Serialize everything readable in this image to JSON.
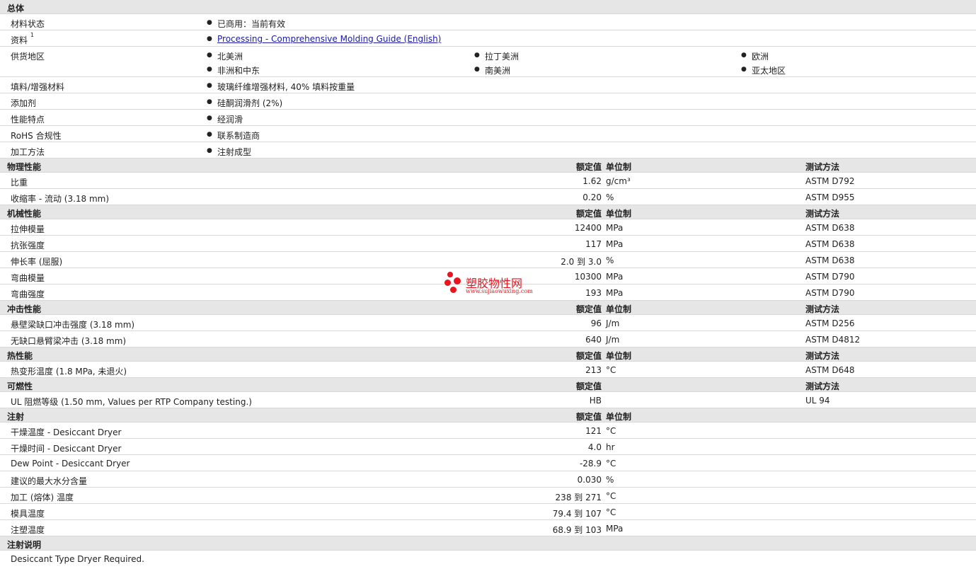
{
  "general": {
    "title": "总体",
    "status_label": "材料状态",
    "status_value": "已商用：当前有效",
    "docs_label": "资料",
    "docs_sup": "1",
    "docs_link": "Processing - Comprehensive Molding Guide (English)",
    "supply_label": "供货地区",
    "regions": [
      "北美洲",
      "拉丁美洲",
      "欧洲",
      "非洲和中东",
      "南美洲",
      "亚太地区"
    ],
    "filler_label": "填料/增强材料",
    "filler_value": "玻璃纤维增强材料, 40% 填料按重量",
    "additive_label": "添加剂",
    "additive_value": "硅酮润滑剂 (2%)",
    "features_label": "性能特点",
    "features_value": "经润滑",
    "rohs_label": "RoHS 合规性",
    "rohs_value": "联系制造商",
    "process_label": "加工方法",
    "process_value": "注射成型"
  },
  "headers": {
    "value": "额定值",
    "unit": "单位制",
    "test": "测试方法"
  },
  "sections": [
    {
      "title": "物理性能",
      "rows": [
        {
          "label": "比重",
          "value": "1.62",
          "unit": "g/cm³",
          "test": "ASTM D792"
        },
        {
          "label": "收缩率  - 流动 (3.18 mm)",
          "value": "0.20",
          "unit": "%",
          "test": "ASTM D955"
        }
      ]
    },
    {
      "title": "机械性能",
      "rows": [
        {
          "label": "拉伸模量",
          "value": "12400",
          "unit": "MPa",
          "test": "ASTM D638"
        },
        {
          "label": "抗张强度",
          "value": "117",
          "unit": "MPa",
          "test": "ASTM D638"
        },
        {
          "label": "伸长率 (屈服)",
          "value": "2.0 到  3.0",
          "unit": "%",
          "test": "ASTM D638"
        },
        {
          "label": "弯曲模量",
          "value": "10300",
          "unit": "MPa",
          "test": "ASTM D790"
        },
        {
          "label": "弯曲强度",
          "value": "193",
          "unit": "MPa",
          "test": "ASTM D790"
        }
      ]
    },
    {
      "title": "冲击性能",
      "rows": [
        {
          "label": "悬壁梁缺口冲击强度 (3.18 mm)",
          "value": "96",
          "unit": "J/m",
          "test": "ASTM D256"
        },
        {
          "label": "无缺口悬臂梁冲击 (3.18 mm)",
          "value": "640",
          "unit": "J/m",
          "test": "ASTM D4812"
        }
      ]
    },
    {
      "title": "热性能",
      "rows": [
        {
          "label": "热变形温度 (1.8 MPa, 未退火)",
          "value": "213",
          "unit": "°C",
          "test": "ASTM D648"
        }
      ]
    },
    {
      "title": "可燃性",
      "no_unit": true,
      "rows": [
        {
          "label": "UL 阻燃等级 (1.50 mm, Values per RTP Company testing.)",
          "value": "HB",
          "unit": "",
          "test": "UL 94"
        }
      ]
    },
    {
      "title": "注射",
      "no_test": true,
      "rows": [
        {
          "label": "干燥温度  - Desiccant Dryer",
          "value": "121",
          "unit": "°C",
          "test": ""
        },
        {
          "label": "干燥时间  - Desiccant Dryer",
          "value": "4.0",
          "unit": "hr",
          "test": ""
        },
        {
          "label": "Dew Point - Desiccant Dryer",
          "value": "-28.9",
          "unit": "°C",
          "test": ""
        },
        {
          "label": "建议的最大水分含量",
          "value": "0.030",
          "unit": "%",
          "test": ""
        },
        {
          "label": "加工 (熔体) 温度",
          "value": "238 到  271",
          "unit": "°C",
          "test": ""
        },
        {
          "label": "模具温度",
          "value": "79.4 到  107",
          "unit": "°C",
          "test": ""
        },
        {
          "label": "注塑温度",
          "value": "68.9 到  103",
          "unit": "MPa",
          "test": ""
        }
      ]
    }
  ],
  "notes": {
    "title": "注射说明",
    "text": "Desiccant Type Dryer Required."
  },
  "watermark": {
    "text": "塑胶物性网",
    "url": "www.sujiaowuxing.com",
    "color": "#e8141e"
  }
}
